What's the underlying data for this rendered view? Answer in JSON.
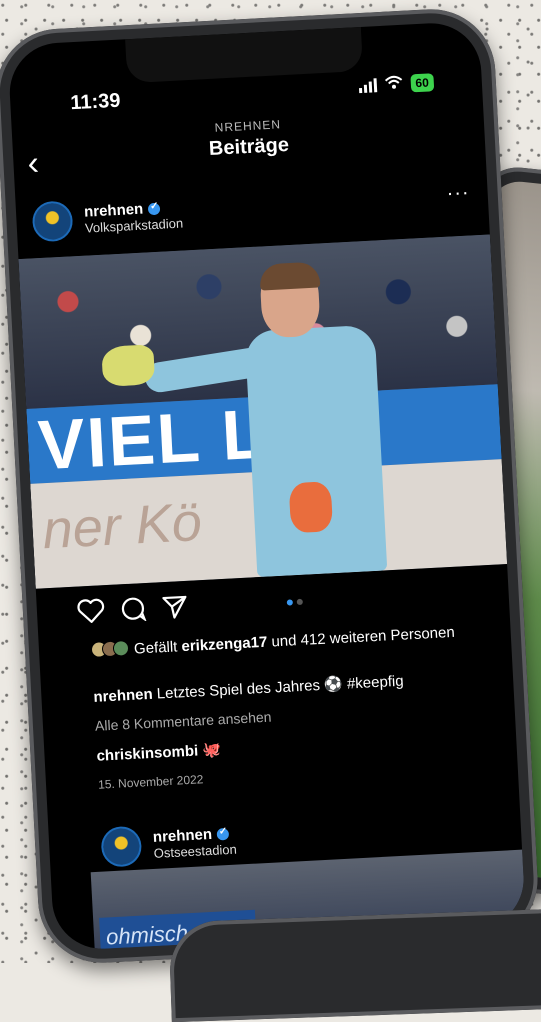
{
  "status_bar": {
    "time": "11:39",
    "battery": "60"
  },
  "header": {
    "account": "NREHNEN",
    "title": "Beiträge"
  },
  "post": {
    "username": "nrehnen",
    "location": "Volksparkstadion",
    "photo_board_text": "VIEL LAI",
    "photo_board_text2": "ner   Kö",
    "likes_prefix": "Gefällt",
    "likes_user": "erikzenga17",
    "likes_suffix": "und 412 weiteren Personen",
    "caption_user": "nrehnen",
    "caption_text": "Letztes Spiel des Jahres ⚽ #keepfig",
    "view_comments": "Alle 8 Kommentare ansehen",
    "comment_user": "chriskinsombi",
    "comment_emoji": "🐙",
    "date": "15. November 2022",
    "carousel_index": 1,
    "carousel_total": 2
  },
  "post2": {
    "username": "nrehnen",
    "location": "Ostseestadion",
    "banner_text": "ohmisch.com"
  },
  "colors": {
    "verified": "#3897f0",
    "battery": "#3dd34d",
    "board": "#2a78c9"
  }
}
